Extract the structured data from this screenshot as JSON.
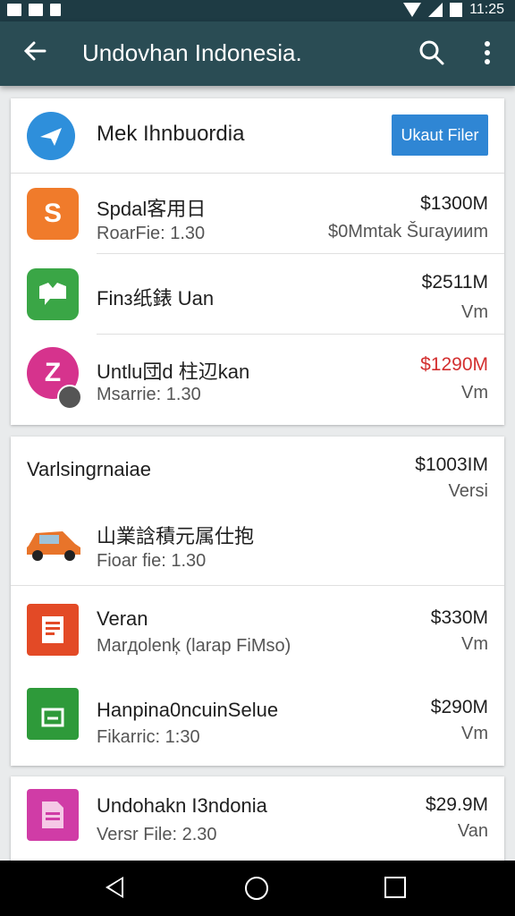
{
  "status_bar": {
    "time": "11:25"
  },
  "app_bar": {
    "title": "Undovhan Indonesia."
  },
  "card1": {
    "header": {
      "title": "Mek Ihnbuordia",
      "button_label": "Ukaut Filer"
    },
    "rows": [
      {
        "name": "Spdal客用日",
        "sub": "Roar​Fie: 1.30",
        "price": "$1300M",
        "detail": "$0Mmtak Šuгауииm",
        "icon": "s-logo-icon",
        "color": "#f07b2b"
      },
      {
        "name": "Finз纸錶 Uan",
        "sub": "",
        "price": "$2511M",
        "detail": "Vm",
        "icon": "chat-bubble-icon",
        "color": "#3aa646"
      },
      {
        "name": "Untlu団d 柱辺kan",
        "sub": "Msarrie: 1.30",
        "price": "$1290M",
        "detail": "Vm",
        "icon": "z-logo-icon",
        "color": "#d6338d",
        "price_color": "red"
      }
    ]
  },
  "card2": {
    "header": {
      "title": "Varlsingrnaiae",
      "price": "$1003IM",
      "detail": "Versi"
    },
    "rows": [
      {
        "name": "山業誝積元属仕抱",
        "sub": "Fioar fie: 1.30",
        "icon": "car-icon"
      },
      {
        "name": "Veran",
        "sub": "Marдolenķ (larap FiMso)",
        "price": "$330M",
        "detail": "Vm",
        "icon": "document-icon",
        "color": "#e34a26"
      },
      {
        "name": "Hanpina0ncuinSelue",
        "sub": "Fikarric: 1:30",
        "price": "$290M",
        "detail": "Vm",
        "icon": "bag-icon",
        "color": "#2e9a3a"
      }
    ]
  },
  "card3": {
    "rows": [
      {
        "name": "Undohakn I3ndonia",
        "sub": "Versr File: 2.30",
        "price": "$29.9M",
        "detail": "Van",
        "icon": "file-icon",
        "color": "#d03ca6"
      }
    ]
  }
}
